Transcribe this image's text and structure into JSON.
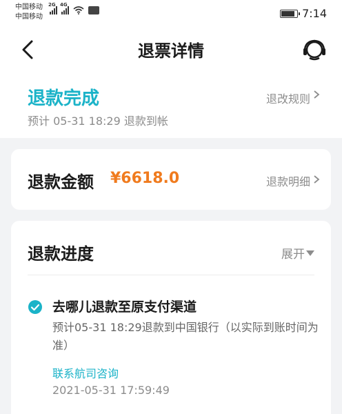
{
  "status_bar": {
    "carrier_1": "中国移动",
    "carrier_2": "中国移动",
    "sig1_tag": "2G",
    "sig2_tag": "4G",
    "time": "7:14"
  },
  "nav": {
    "title": "退票详情"
  },
  "status_section": {
    "status": "退款完成",
    "eta": "预计 05-31 18:29 退款到帐",
    "rules_link": "退改规则"
  },
  "amount_card": {
    "label": "退款金额",
    "amount": "¥6618.0",
    "detail_link": "退款明细"
  },
  "progress_card": {
    "title": "退款进度",
    "expand_label": "展开",
    "step": {
      "title": "去哪儿退款至原支付渠道",
      "description": "预计05-31 18:29退款到中国银行（以实际到账时间为准）",
      "contact_link": "联系航司咨询",
      "timestamp": "2021-05-31 17:59:49"
    }
  },
  "colors": {
    "accent": "#1bb3c8",
    "amount": "#f07b1e",
    "muted": "#8c8c8c",
    "background": "#f2f3f5"
  },
  "icons": [
    "back-arrow-icon",
    "customer-service-icon",
    "chevron-right-icon",
    "triangle-down-icon",
    "check-circle-icon",
    "wifi-icon",
    "battery-icon"
  ]
}
